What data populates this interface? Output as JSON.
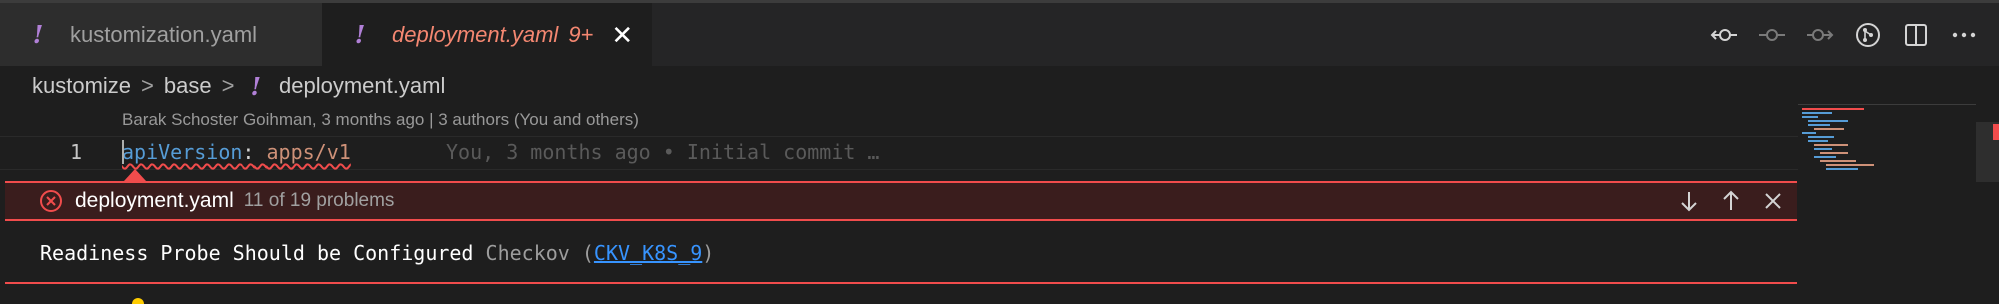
{
  "tabs": [
    {
      "label": "kustomization.yaml",
      "icon": "yaml-exclamation-icon",
      "active": false
    },
    {
      "label": "deployment.yaml",
      "badge": "9+",
      "icon": "yaml-exclamation-icon",
      "active": true
    }
  ],
  "tab_yaml_glyph": "!",
  "tab_close_glyph": "✕",
  "breadcrumb": {
    "folder1": "kustomize",
    "folder2": "base",
    "file": "deployment.yaml",
    "separator": ">",
    "yaml_glyph": "!"
  },
  "editor": {
    "codelens": "Barak Schoster Goihman, 3 months ago | 3 authors (You and others)",
    "line_number": "1",
    "code_key": "apiVersion",
    "code_colon": ":",
    "code_value": "apps/v1",
    "blame": "You, 3 months ago • Initial commit …"
  },
  "peek": {
    "file": "deployment.yaml",
    "count": "11 of 19 problems",
    "message": "Readiness Probe Should be Configured",
    "source": "Checkov",
    "open_paren": " (",
    "code": "CKV_K8S_9",
    "close_paren": ")"
  },
  "colors": {
    "error": "#f14c4c",
    "yaml_icon": "#b180d7",
    "active_tab_text": "#f48771",
    "link": "#3794ff"
  }
}
